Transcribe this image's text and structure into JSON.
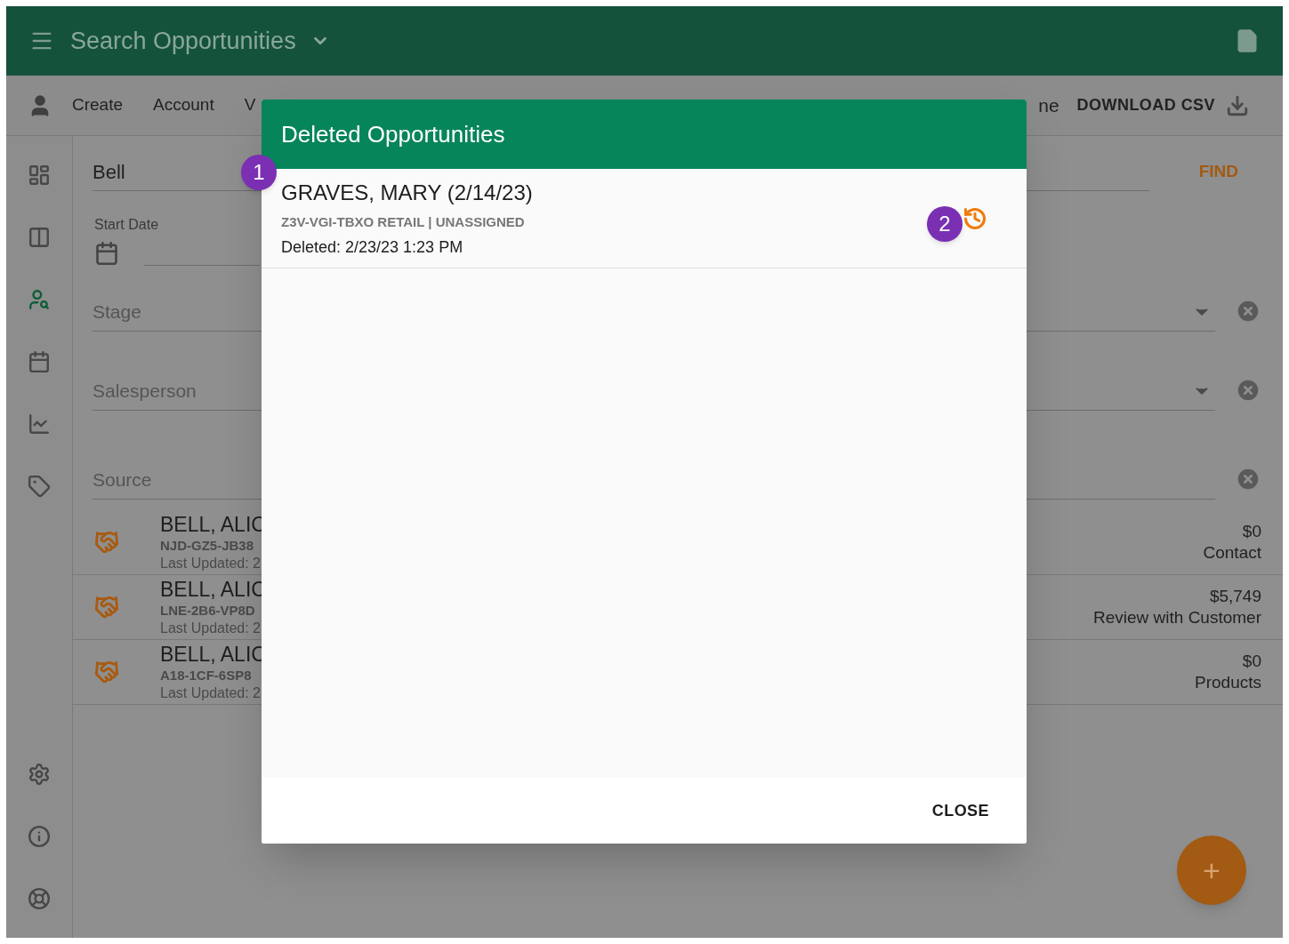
{
  "app_bar": {
    "title": "Search Opportunities"
  },
  "toolbar": {
    "tabs": [
      {
        "label": "Create"
      },
      {
        "label": "Account"
      },
      {
        "label": "V"
      }
    ],
    "cut_tab": "ne",
    "download_button": "DOWNLOAD CSV"
  },
  "sidebar": {
    "items": [
      {
        "kind": "dashboard",
        "selected": false
      },
      {
        "kind": "board",
        "selected": false
      },
      {
        "kind": "search-person",
        "selected": true
      },
      {
        "kind": "calendar",
        "selected": false
      },
      {
        "kind": "chart",
        "selected": false
      },
      {
        "kind": "tag",
        "selected": false
      }
    ],
    "bottom_items": [
      {
        "kind": "settings"
      },
      {
        "kind": "info"
      },
      {
        "kind": "help"
      }
    ]
  },
  "search": {
    "value": "Bell",
    "find_button": "FIND",
    "start_date_label": "Start Date",
    "filters": [
      {
        "placeholder": "Stage",
        "kind": "select"
      },
      {
        "placeholder": "Salesperson",
        "kind": "select"
      },
      {
        "placeholder": "Source",
        "kind": "text"
      }
    ]
  },
  "results": [
    {
      "name": "BELL, ALIC",
      "code": "NJD-GZ5-JB38",
      "updated": "Last Updated: 2",
      "amount": "$0",
      "stage": "Contact"
    },
    {
      "name": "BELL, ALIC",
      "code": "LNE-2B6-VP8D",
      "updated": "Last Updated: 2",
      "amount": "$5,749",
      "stage": "Review with Customer"
    },
    {
      "name": "BELL, ALIC",
      "code": "A18-1CF-6SP8",
      "updated": "Last Updated: 2",
      "amount": "$0",
      "stage": "Products"
    }
  ],
  "dialog": {
    "title": "Deleted Opportunities",
    "items": [
      {
        "name": "GRAVES, MARY (2/14/23)",
        "details": "Z3V-VGI-TBXO RETAIL | UNASSIGNED",
        "deleted": "Deleted: 2/23/23 1:23 PM"
      }
    ],
    "close_button": "CLOSE"
  },
  "callouts": [
    "1",
    "2"
  ],
  "fab": "+"
}
